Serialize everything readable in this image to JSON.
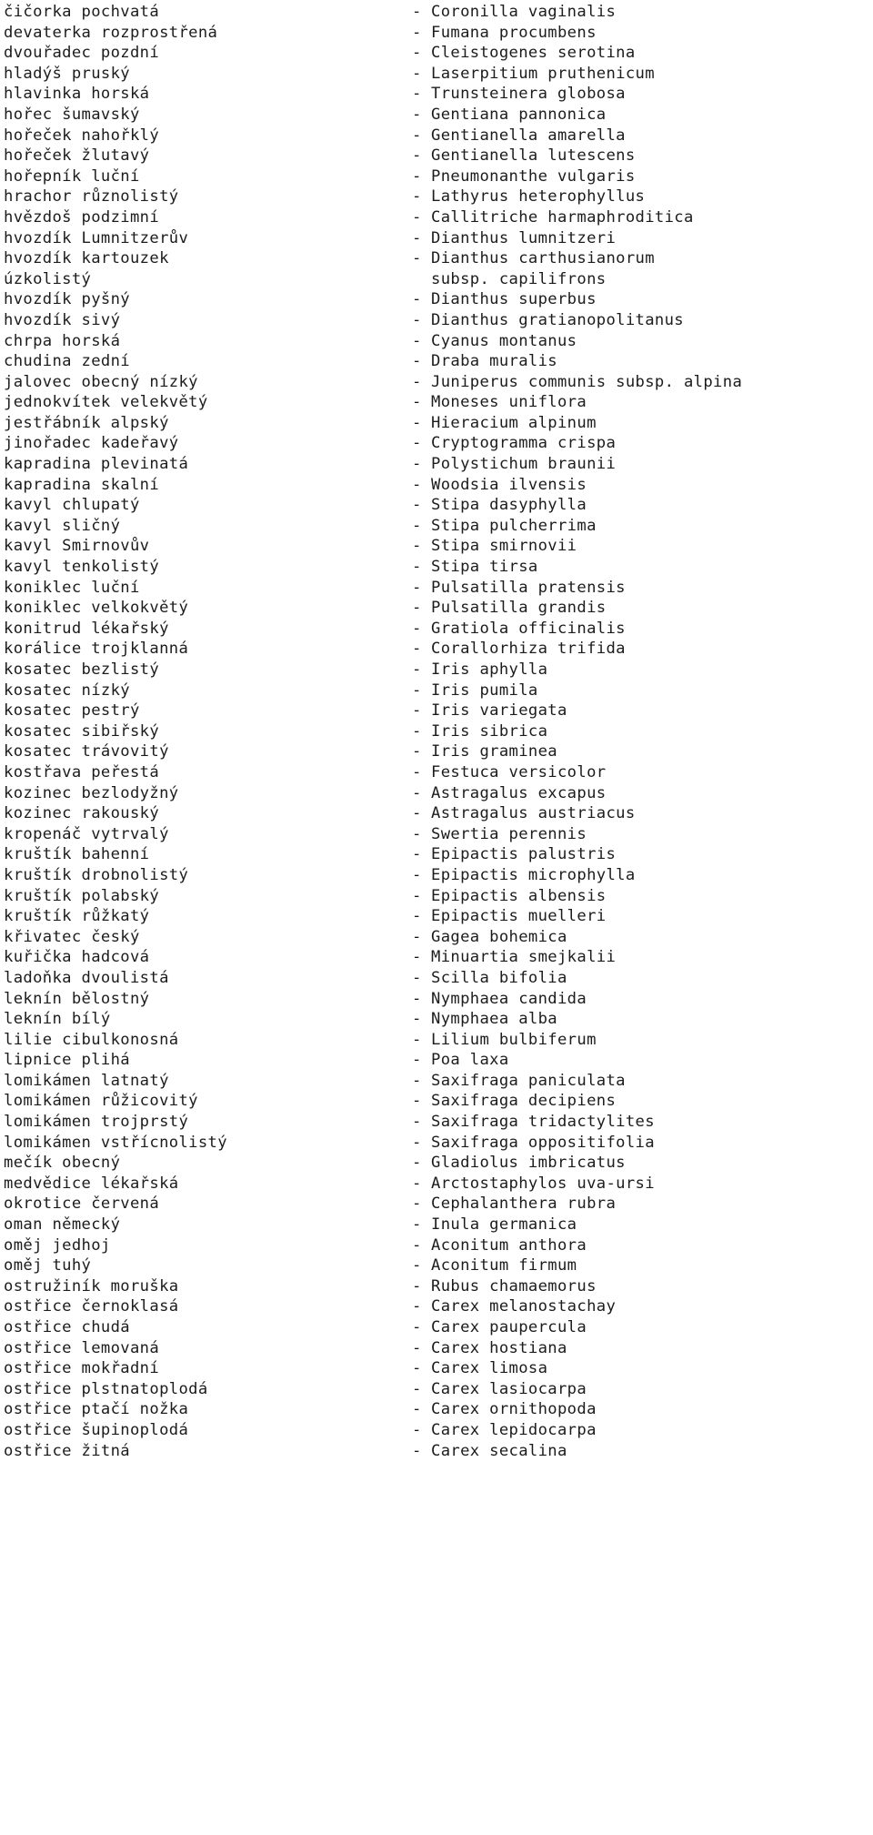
{
  "document": {
    "kind": "plant-name-list",
    "dash_separator": "-",
    "columns": {
      "czech_header": "",
      "latin_header": ""
    }
  },
  "rows": [
    {
      "czech": "čičorka pochvatá",
      "dash": "-",
      "latin": "Coronilla vaginalis",
      "continuation": false
    },
    {
      "czech": "devaterka rozprostřená",
      "dash": "-",
      "latin": "Fumana procumbens",
      "continuation": false
    },
    {
      "czech": "dvouřadec pozdní",
      "dash": "-",
      "latin": "Cleistogenes serotina",
      "continuation": false
    },
    {
      "czech": "hladýš pruský",
      "dash": "-",
      "latin": "Laserpitium pruthenicum",
      "continuation": false
    },
    {
      "czech": "hlavinka horská",
      "dash": "-",
      "latin": "Trunsteinera globosa",
      "continuation": false
    },
    {
      "czech": "hořec šumavský",
      "dash": "-",
      "latin": "Gentiana pannonica",
      "continuation": false
    },
    {
      "czech": "hořeček nahořklý",
      "dash": "-",
      "latin": "Gentianella amarella",
      "continuation": false
    },
    {
      "czech": "hořeček žlutavý",
      "dash": "-",
      "latin": "Gentianella lutescens",
      "continuation": false
    },
    {
      "czech": "hořepník luční",
      "dash": "-",
      "latin": "Pneumonanthe vulgaris",
      "continuation": false
    },
    {
      "czech": "hrachor různolistý",
      "dash": "-",
      "latin": "Lathyrus heterophyllus",
      "continuation": false
    },
    {
      "czech": "hvězdoš podzimní",
      "dash": "-",
      "latin": "Callitriche harmaphroditica",
      "continuation": false
    },
    {
      "czech": "hvozdík Lumnitzerův",
      "dash": "-",
      "latin": "Dianthus lumnitzeri",
      "continuation": false
    },
    {
      "czech": "hvozdík kartouzek",
      "dash": "-",
      "latin": "Dianthus carthusianorum",
      "continuation": false
    },
    {
      "czech": "úzkolistý",
      "dash": "-",
      "latin": "subsp. capilifrons",
      "continuation": true
    },
    {
      "czech": "hvozdík pyšný",
      "dash": "-",
      "latin": "Dianthus superbus",
      "continuation": false
    },
    {
      "czech": "hvozdík sivý",
      "dash": "-",
      "latin": "Dianthus gratianopolitanus",
      "continuation": false
    },
    {
      "czech": "chrpa horská",
      "dash": "-",
      "latin": "Cyanus montanus",
      "continuation": false
    },
    {
      "czech": "chudina zední",
      "dash": "-",
      "latin": "Draba muralis",
      "continuation": false
    },
    {
      "czech": "jalovec obecný nízký",
      "dash": "-",
      "latin": "Juniperus communis subsp. alpina",
      "continuation": false
    },
    {
      "czech": "jednokvítek velekvětý",
      "dash": "-",
      "latin": "Moneses uniflora",
      "continuation": false
    },
    {
      "czech": "jestřábník alpský",
      "dash": "-",
      "latin": "Hieracium alpinum",
      "continuation": false
    },
    {
      "czech": "jinořadec kadeřavý",
      "dash": "-",
      "latin": "Cryptogramma crispa",
      "continuation": false
    },
    {
      "czech": "kapradina plevinatá",
      "dash": "-",
      "latin": "Polystichum braunii",
      "continuation": false
    },
    {
      "czech": "kapradina skalní",
      "dash": "-",
      "latin": "Woodsia ilvensis",
      "continuation": false
    },
    {
      "czech": "kavyl chlupatý",
      "dash": "-",
      "latin": "Stipa dasyphylla",
      "continuation": false
    },
    {
      "czech": "kavyl sličný",
      "dash": "-",
      "latin": "Stipa pulcherrima",
      "continuation": false
    },
    {
      "czech": "kavyl Smirnovův",
      "dash": "-",
      "latin": "Stipa smirnovii",
      "continuation": false
    },
    {
      "czech": "kavyl tenkolistý",
      "dash": "-",
      "latin": "Stipa tirsa",
      "continuation": false
    },
    {
      "czech": "koniklec luční",
      "dash": "-",
      "latin": "Pulsatilla pratensis",
      "continuation": false
    },
    {
      "czech": "koniklec velkokvětý",
      "dash": "-",
      "latin": "Pulsatilla grandis",
      "continuation": false
    },
    {
      "czech": "konitrud lékařský",
      "dash": "-",
      "latin": "Gratiola officinalis",
      "continuation": false
    },
    {
      "czech": "korálice trojklanná",
      "dash": "-",
      "latin": "Corallorhiza trifida",
      "continuation": false
    },
    {
      "czech": "kosatec bezlistý",
      "dash": "-",
      "latin": "Iris aphylla",
      "continuation": false
    },
    {
      "czech": "kosatec nízký",
      "dash": "-",
      "latin": "Iris pumila",
      "continuation": false
    },
    {
      "czech": "kosatec pestrý",
      "dash": "-",
      "latin": "Iris variegata",
      "continuation": false
    },
    {
      "czech": "kosatec sibiřský",
      "dash": "-",
      "latin": "Iris sibrica",
      "continuation": false
    },
    {
      "czech": "kosatec trávovitý",
      "dash": "-",
      "latin": "Iris graminea",
      "continuation": false
    },
    {
      "czech": "kostřava peřestá",
      "dash": "-",
      "latin": "Festuca versicolor",
      "continuation": false
    },
    {
      "czech": "kozinec bezlodyžný",
      "dash": "-",
      "latin": "Astragalus excapus",
      "continuation": false
    },
    {
      "czech": "kozinec rakouský",
      "dash": "-",
      "latin": "Astragalus austriacus",
      "continuation": false
    },
    {
      "czech": "kropenáč vytrvalý",
      "dash": "-",
      "latin": "Swertia perennis",
      "continuation": false
    },
    {
      "czech": "kruštík bahenní",
      "dash": "-",
      "latin": "Epipactis palustris",
      "continuation": false
    },
    {
      "czech": "kruštík drobnolistý",
      "dash": "-",
      "latin": "Epipactis microphylla",
      "continuation": false
    },
    {
      "czech": "kruštík polabský",
      "dash": "-",
      "latin": "Epipactis albensis",
      "continuation": false
    },
    {
      "czech": "kruštík růžkatý",
      "dash": "-",
      "latin": "Epipactis muelleri",
      "continuation": false
    },
    {
      "czech": "křivatec český",
      "dash": "-",
      "latin": "Gagea bohemica",
      "continuation": false
    },
    {
      "czech": "kuřička hadcová",
      "dash": "-",
      "latin": "Minuartia smejkalii",
      "continuation": false
    },
    {
      "czech": "ladoňka dvoulistá",
      "dash": "-",
      "latin": "Scilla bifolia",
      "continuation": false
    },
    {
      "czech": "leknín bělostný",
      "dash": "-",
      "latin": "Nymphaea candida",
      "continuation": false
    },
    {
      "czech": "leknín bílý",
      "dash": "-",
      "latin": "Nymphaea alba",
      "continuation": false
    },
    {
      "czech": "lilie cibulkonosná",
      "dash": "-",
      "latin": "Lilium bulbiferum",
      "continuation": false
    },
    {
      "czech": "lipnice plihá",
      "dash": "-",
      "latin": "Poa laxa",
      "continuation": false
    },
    {
      "czech": "lomikámen latnatý",
      "dash": "-",
      "latin": "Saxifraga paniculata",
      "continuation": false
    },
    {
      "czech": "lomikámen růžicovitý",
      "dash": "-",
      "latin": "Saxifraga decipiens",
      "continuation": false
    },
    {
      "czech": "lomikámen trojprstý",
      "dash": "-",
      "latin": "Saxifraga tridactylites",
      "continuation": false
    },
    {
      "czech": "lomikámen vstřícnolistý",
      "dash": "-",
      "latin": "Saxifraga oppositifolia",
      "continuation": false
    },
    {
      "czech": "mečík obecný",
      "dash": "-",
      "latin": "Gladiolus imbricatus",
      "continuation": false
    },
    {
      "czech": "medvědice lékařská",
      "dash": "-",
      "latin": "Arctostaphylos uva-ursi",
      "continuation": false
    },
    {
      "czech": "okrotice červená",
      "dash": "-",
      "latin": "Cephalanthera rubra",
      "continuation": false
    },
    {
      "czech": "oman německý",
      "dash": "-",
      "latin": "Inula germanica",
      "continuation": false
    },
    {
      "czech": "oměj jedhoj",
      "dash": "-",
      "latin": "Aconitum anthora",
      "continuation": false
    },
    {
      "czech": "oměj tuhý",
      "dash": "-",
      "latin": "Aconitum firmum",
      "continuation": false
    },
    {
      "czech": "ostružiník moruška",
      "dash": "-",
      "latin": "Rubus chamaemorus",
      "continuation": false
    },
    {
      "czech": "ostřice černoklasá",
      "dash": "-",
      "latin": "Carex melanostachay",
      "continuation": false
    },
    {
      "czech": "ostřice chudá",
      "dash": "-",
      "latin": "Carex paupercula",
      "continuation": false
    },
    {
      "czech": "ostřice lemovaná",
      "dash": "-",
      "latin": "Carex hostiana",
      "continuation": false
    },
    {
      "czech": "ostřice mokřadní",
      "dash": "-",
      "latin": "Carex limosa",
      "continuation": false
    },
    {
      "czech": "ostřice plstnatoplodá",
      "dash": "-",
      "latin": "Carex lasiocarpa",
      "continuation": false
    },
    {
      "czech": "ostřice ptačí nožka",
      "dash": "-",
      "latin": "Carex ornithopoda",
      "continuation": false
    },
    {
      "czech": "ostřice šupinoplodá",
      "dash": "-",
      "latin": "Carex lepidocarpa",
      "continuation": false
    },
    {
      "czech": "ostřice žitná",
      "dash": "-",
      "latin": "Carex secalina",
      "continuation": false
    }
  ]
}
